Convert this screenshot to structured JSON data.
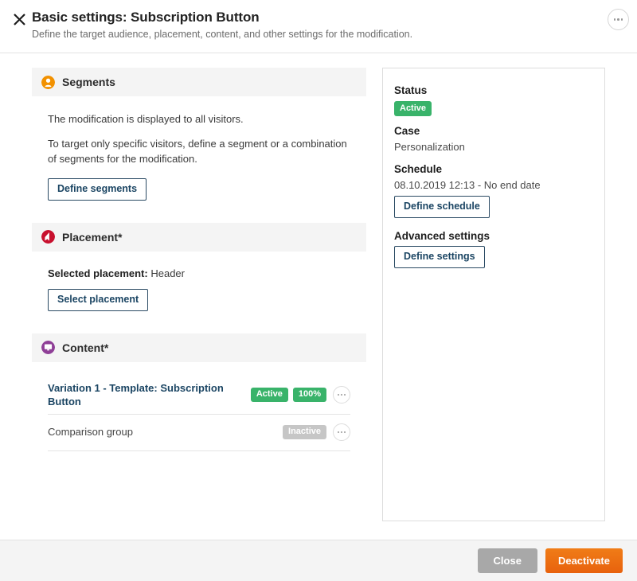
{
  "header": {
    "close_icon": "close-icon",
    "title": "Basic settings: Subscription Button",
    "subtitle": "Define the target audience, placement, content, and other settings for the modification.",
    "more_icon": "ellipsis-icon"
  },
  "sections": {
    "segments": {
      "icon": "segments-person-icon",
      "icon_color": "#f29100",
      "title": "Segments",
      "paragraph1": "The modification is displayed to all visitors.",
      "paragraph2": "To target only specific visitors, define a segment or a combination of segments for the modification.",
      "button_label": "Define segments"
    },
    "placement": {
      "icon": "placement-cursor-icon",
      "icon_color": "#c8102e",
      "title": "Placement*",
      "selected_label": "Selected placement:",
      "selected_value": "Header",
      "button_label": "Select placement"
    },
    "content": {
      "icon": "content-monitor-icon",
      "icon_color": "#8f3f97",
      "title": "Content*",
      "variations": [
        {
          "name": "Variation 1 - Template: Subscription Button",
          "is_link": true,
          "badges": [
            {
              "label": "Active",
              "style": "green"
            },
            {
              "label": "100%",
              "style": "green"
            }
          ],
          "more_icon": "ellipsis-icon"
        },
        {
          "name": "Comparison group",
          "is_link": false,
          "badges": [
            {
              "label": "Inactive",
              "style": "grey"
            }
          ],
          "more_icon": "ellipsis-icon"
        }
      ]
    }
  },
  "right_panel": {
    "status_label": "Status",
    "status_badge": "Active",
    "case_label": "Case",
    "case_value": "Personalization",
    "schedule_label": "Schedule",
    "schedule_value": "08.10.2019 12:13 - No end date",
    "schedule_button": "Define schedule",
    "advanced_label": "Advanced settings",
    "advanced_button": "Define settings"
  },
  "footer": {
    "close_label": "Close",
    "deactivate_label": "Deactivate"
  },
  "colors": {
    "green_badge": "#39b36a",
    "grey_badge": "#c6c6c6",
    "orange_primary": "#e8620d",
    "link_blue": "#1b4563"
  }
}
